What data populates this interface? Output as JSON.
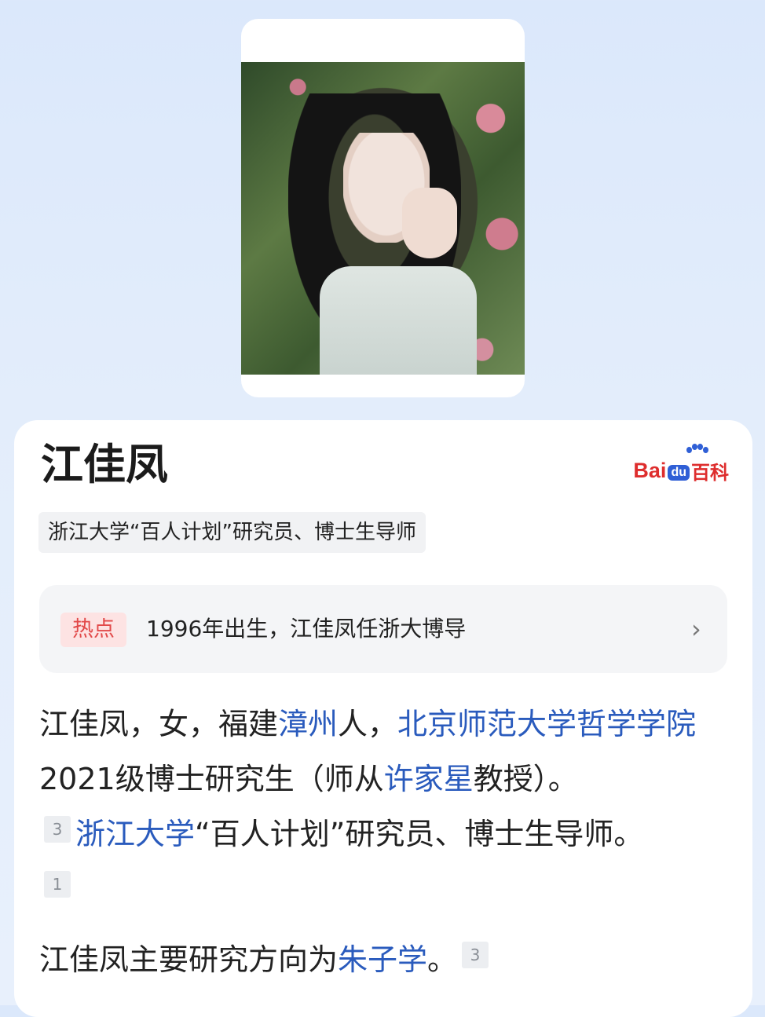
{
  "title": "江佳凤",
  "logo": {
    "bai": "Bai",
    "du": "du",
    "baike": "百科"
  },
  "subtitle": "浙江大学“百人计划”研究员、博士生导师",
  "hot": {
    "tag": "热点",
    "text": "1996年出生，江佳凤任浙大博导"
  },
  "intro": {
    "p1_a": "江佳凤，女，福建",
    "p1_link1": "漳州",
    "p1_b": "人，",
    "p1_link2": "北京师范大学哲学学院",
    "p1_c": "2021级博士研究生（师从",
    "p1_link3": "许家星",
    "p1_d": "教授）。",
    "ref1": "3",
    "p1_link4": "浙江大学",
    "p1_e": "“百人计划”研究员、博士生导师。",
    "ref2": "1",
    "p2_a": "江佳凤主要研究方向为",
    "p2_link": "朱子学",
    "p2_b": "。",
    "ref3": "3"
  },
  "colors": {
    "link": "#2a5bbd",
    "hot_tag_text": "#e24a4a",
    "brand_red": "#de2d2d",
    "brand_blue": "#2f5fd6"
  }
}
